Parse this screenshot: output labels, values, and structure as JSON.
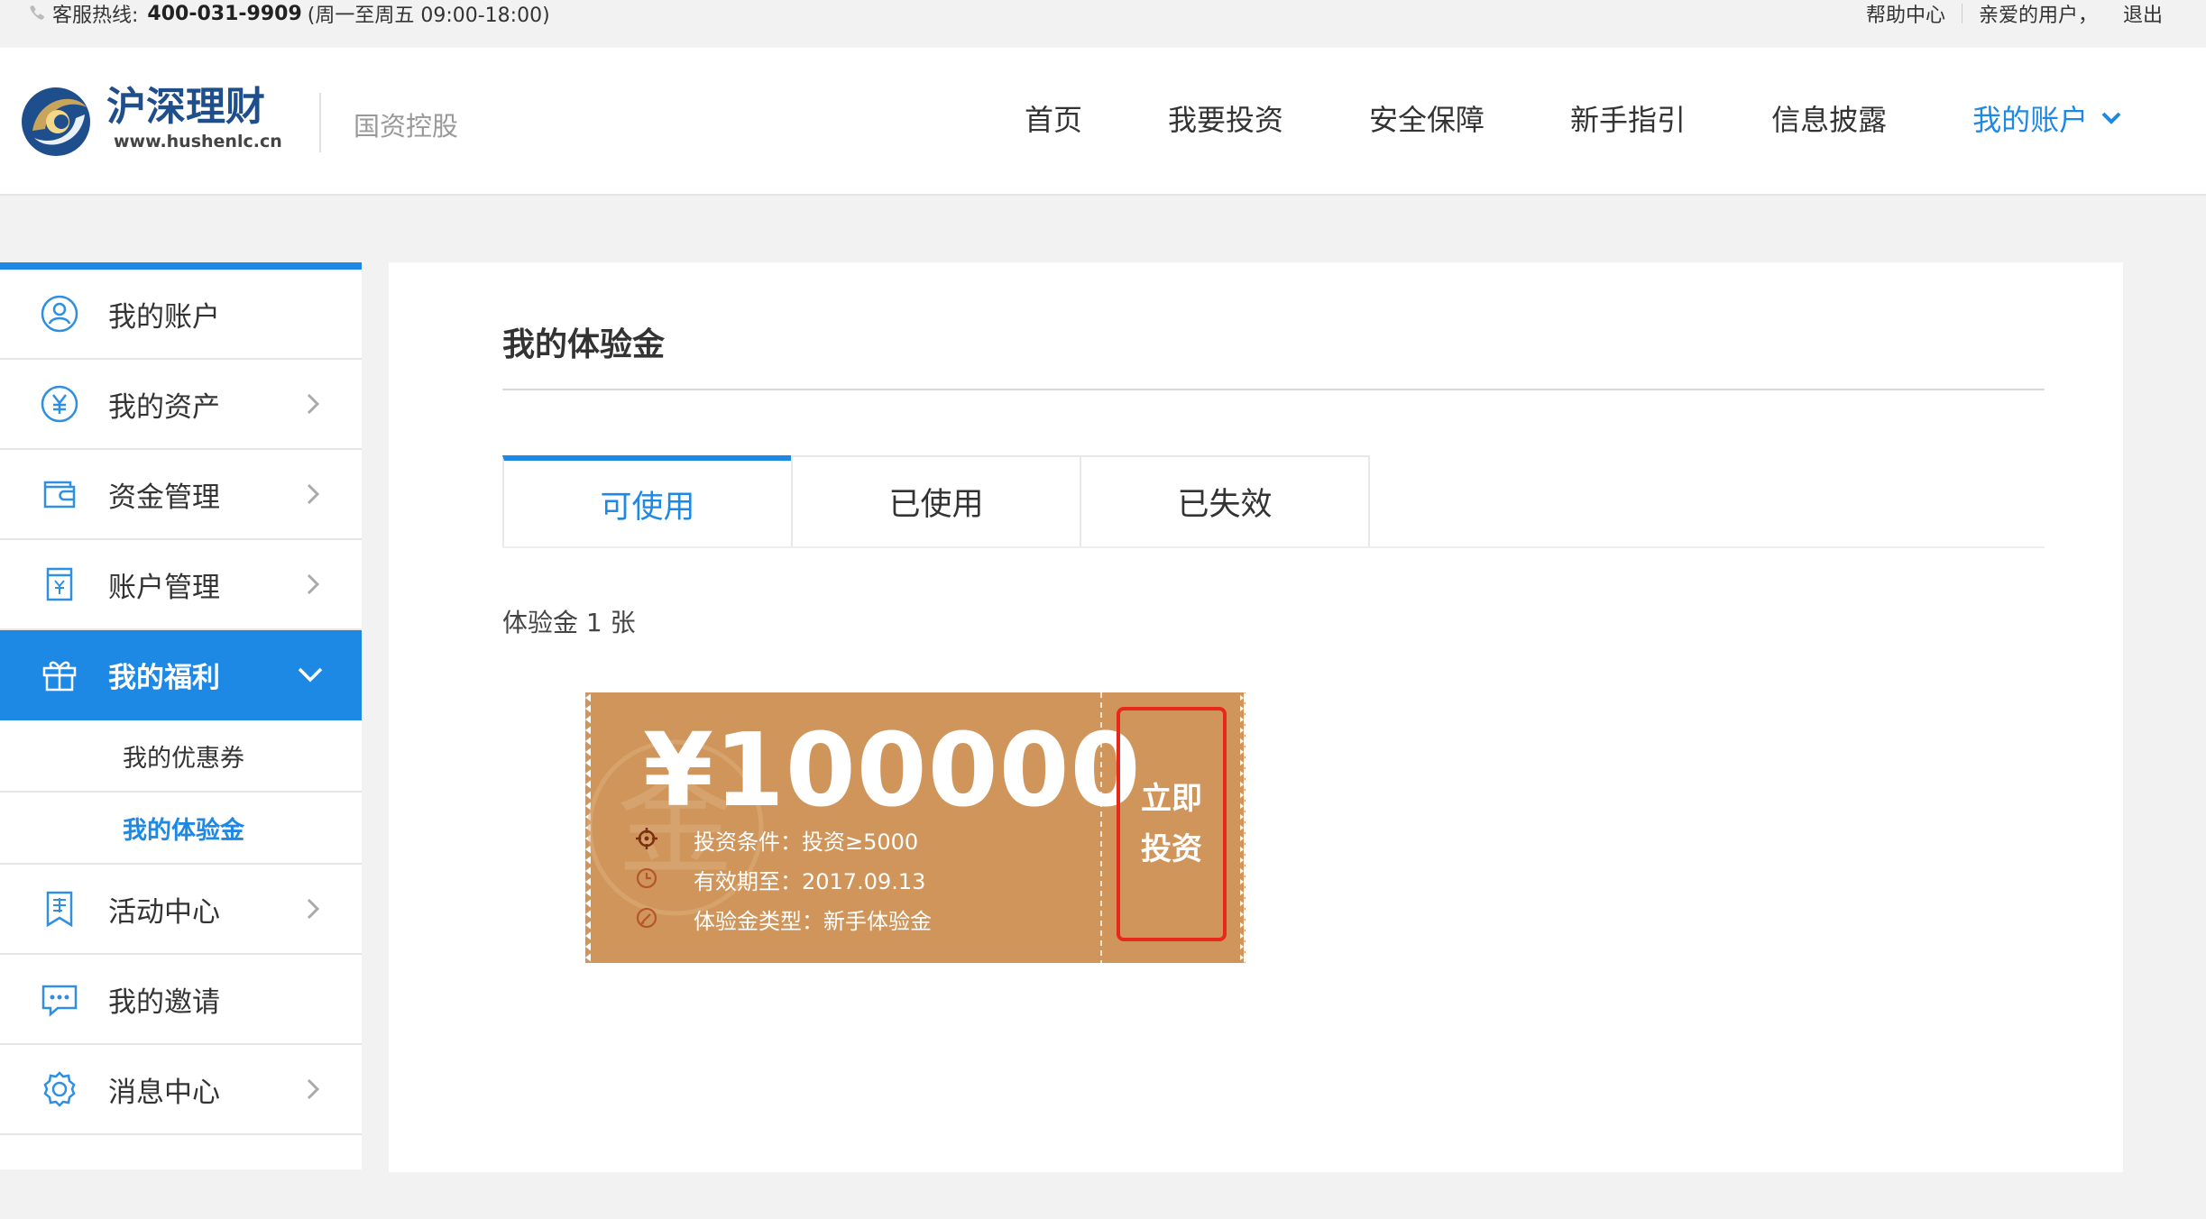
{
  "topbar": {
    "hotline_label": "客服热线:",
    "hotline_number": "400-031-9909",
    "hotline_hours": "(周一至周五 09:00-18:00)",
    "help": "帮助中心",
    "greeting": "亲爱的用户，",
    "logout": "退出"
  },
  "header": {
    "logo_name": "沪深理财",
    "logo_url": "www.hushenlc.cn",
    "subtitle": "国资控股",
    "nav": [
      "首页",
      "我要投资",
      "安全保障",
      "新手指引",
      "信息披露"
    ],
    "nav_active": "我的账户"
  },
  "sidebar": {
    "items": [
      {
        "label": "我的账户",
        "icon": "user-circle-icon"
      },
      {
        "label": "我的资产",
        "icon": "yen-circle-icon"
      },
      {
        "label": "资金管理",
        "icon": "wallet-icon"
      },
      {
        "label": "账户管理",
        "icon": "yen-document-icon"
      },
      {
        "label": "我的福利",
        "icon": "gift-icon"
      },
      {
        "label": "活动中心",
        "icon": "invitation-bookmark-icon"
      },
      {
        "label": "我的邀请",
        "icon": "chat-bubble-icon"
      },
      {
        "label": "消息中心",
        "icon": "gear-icon"
      }
    ],
    "sub_items": [
      "我的优惠券",
      "我的体验金"
    ]
  },
  "main": {
    "title": "我的体验金",
    "tabs": [
      "可使用",
      "已使用",
      "已失效"
    ],
    "count_text": "体验金 1 张"
  },
  "voucher": {
    "watermark": "金",
    "amount": "¥100000",
    "condition": "投资条件：投资≥5000",
    "expiry": "有效期至：2017.09.13",
    "type": "体验金类型：新手体验金",
    "button_line1": "立即",
    "button_line2": "投资"
  },
  "colors": {
    "accent": "#1e88e5",
    "voucher": "#cf955b",
    "button_border": "#e8281a"
  }
}
